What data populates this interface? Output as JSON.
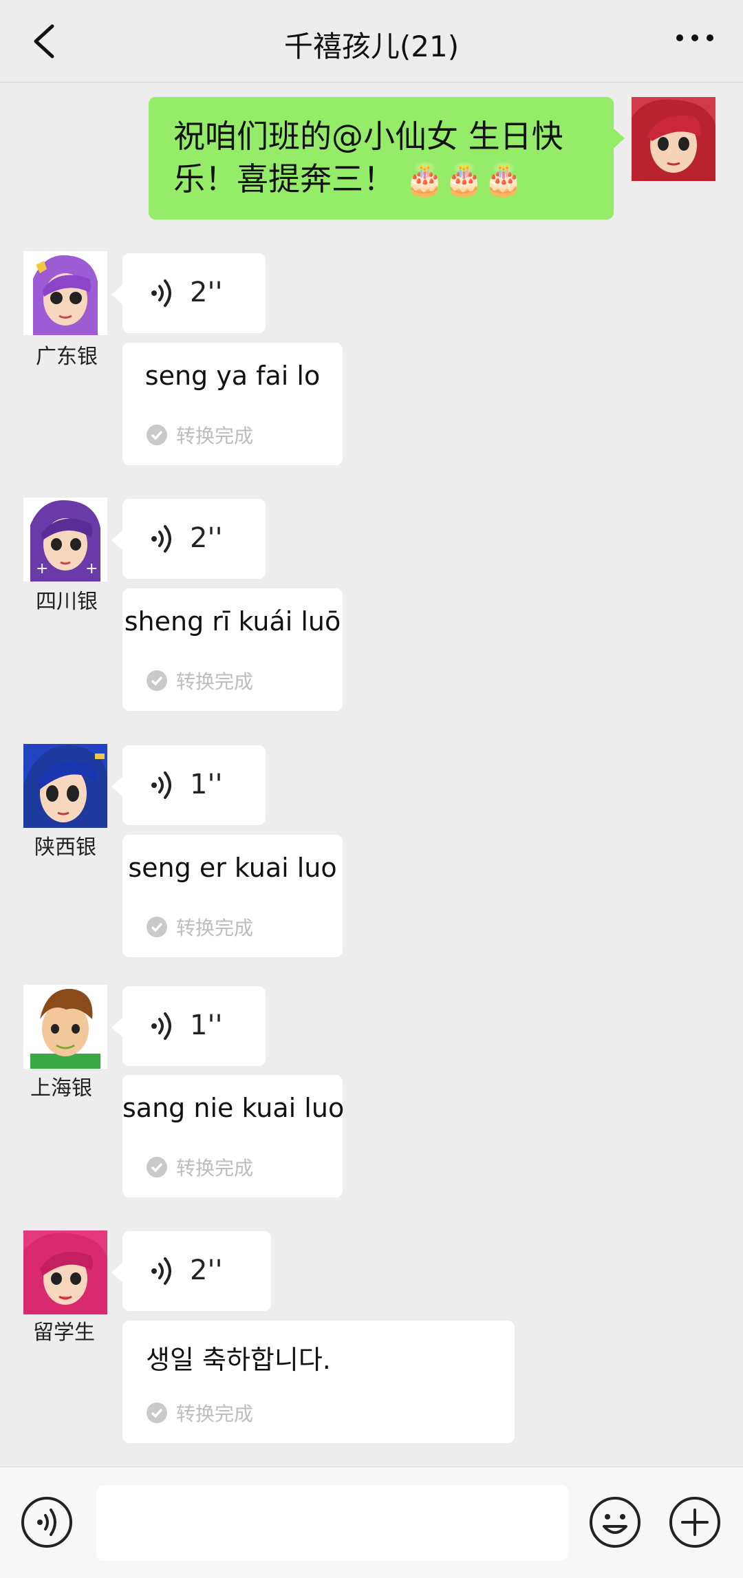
{
  "header": {
    "title": "千禧孩儿(21)"
  },
  "self_message": {
    "text": "祝咱们班的@小仙女 生日快乐！喜提奔三！ 🎂🎂🎂"
  },
  "messages": [
    {
      "nickname": "广东银",
      "voice_duration": "2''",
      "transcript": "seng ya fai lo",
      "status": "转换完成"
    },
    {
      "nickname": "四川银",
      "voice_duration": "2''",
      "transcript": "sheng rī kuái luō",
      "status": "转换完成"
    },
    {
      "nickname": "陕西银",
      "voice_duration": "1''",
      "transcript": "seng er kuai luo",
      "status": "转换完成"
    },
    {
      "nickname": "上海银",
      "voice_duration": "1''",
      "transcript": "sang nie kuai luo",
      "status": "转换完成"
    },
    {
      "nickname": "留学生",
      "voice_duration": "2''",
      "transcript": "생일 축하합니다.",
      "status": "转换完成"
    }
  ],
  "colors": {
    "self_bubble": "#95ec69",
    "background": "#ededed",
    "status_text": "#bdbdbd"
  },
  "icons": [
    "back-arrow-icon",
    "more-dots-icon",
    "voice-wave-icon",
    "check-circle-icon",
    "voice-input-icon",
    "emoji-icon",
    "plus-icon"
  ]
}
